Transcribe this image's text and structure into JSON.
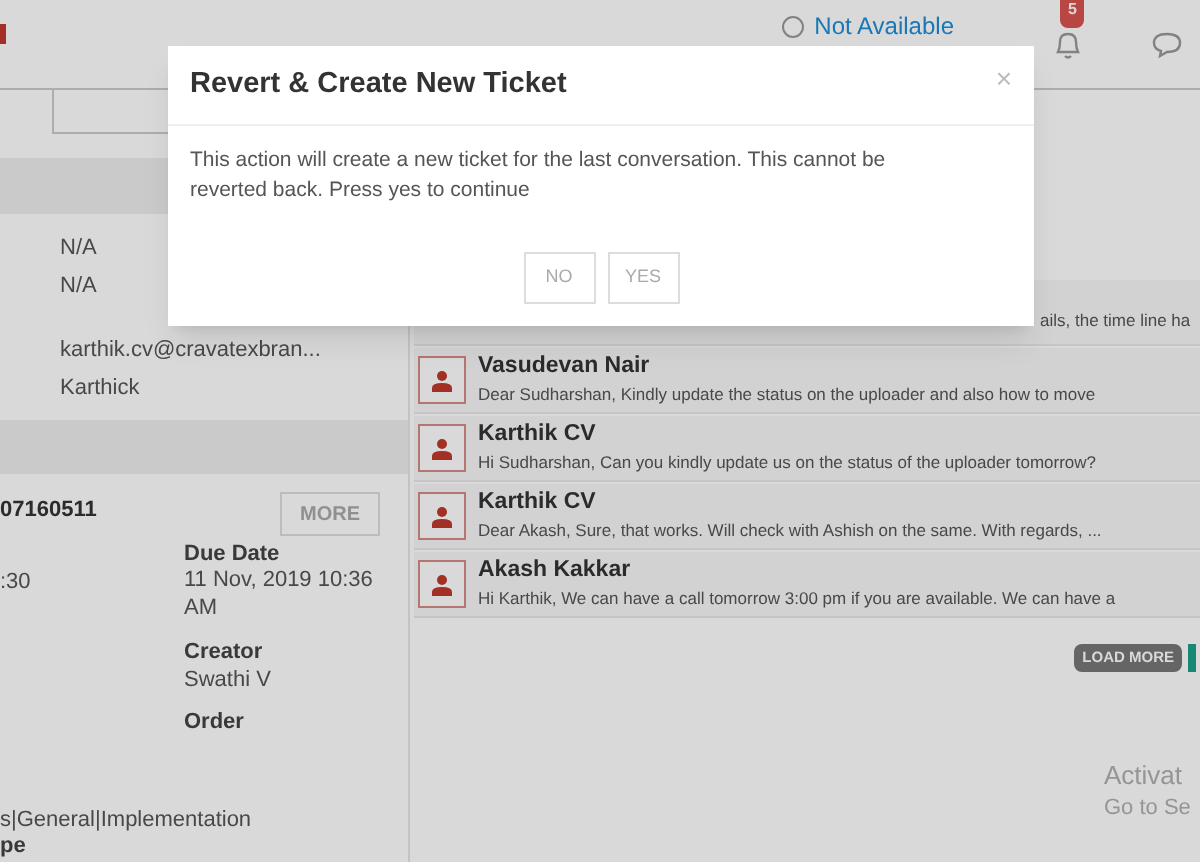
{
  "status": {
    "label": "Not Available",
    "checked": false
  },
  "notifications": {
    "count": "5"
  },
  "contact": {
    "fields": [
      {
        "value": "N/A"
      },
      {
        "value": "N/A"
      },
      {
        "value": "karthik.cv@cravatexbran..."
      },
      {
        "value": "Karthick"
      }
    ]
  },
  "ticket": {
    "number": "07160511",
    "more_button": "MORE",
    "time": ":30",
    "due_date": {
      "label": "Due Date",
      "value": "11 Nov, 2019 10:36 AM"
    },
    "creator": {
      "label": "Creator",
      "value": "Swathi V"
    },
    "order": {
      "label": "Order"
    },
    "category": "s|General|Implementation",
    "type_label": "pe"
  },
  "messages": [
    {
      "text": "ails, the time line ha"
    },
    {
      "sender": "Vasudevan Nair",
      "text": "Dear Sudharshan,  Kindly update the status on the uploader and also how to move"
    },
    {
      "sender": "Karthik CV",
      "text": "Hi Sudharshan, Can you kindly update us on the status of the uploader tomorrow?"
    },
    {
      "sender": "Karthik CV",
      "text": "Dear Akash, Sure, that works. Will check with Ashish on the same. With regards, ..."
    },
    {
      "sender": "Akash Kakkar",
      "text": "Hi Karthik, We can have a call tomorrow 3:00 pm if you are available. We can have a"
    }
  ],
  "load_more": "LOAD MORE",
  "os_notice": [
    "Activat",
    "Go to Se"
  ],
  "dialog": {
    "title": "Revert & Create New Ticket",
    "close": "×",
    "body": "This action will create a new ticket for the last conversation. This cannot be reverted back. Press yes to continue",
    "buttons": [
      "NO",
      "YES"
    ]
  }
}
